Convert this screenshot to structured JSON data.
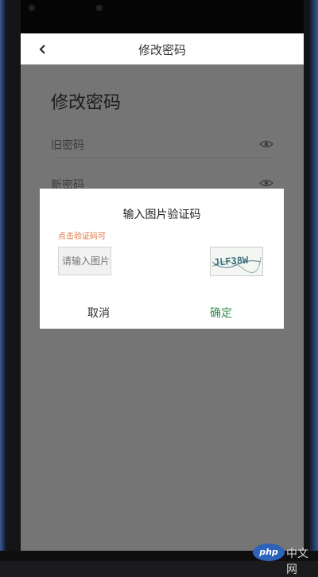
{
  "header": {
    "title": "修改密码"
  },
  "page": {
    "title": "修改密码",
    "old_password_label": "旧密码",
    "new_password_label": "新密码"
  },
  "dialog": {
    "title": "输入图片验证码",
    "hint": "点击验证码可",
    "captcha_placeholder": "请输入图片",
    "cancel_label": "取消",
    "confirm_label": "确定",
    "captcha_image_text": "JLF38W"
  },
  "colors": {
    "overlay": "#757575",
    "confirm": "#3a8c50",
    "hint": "#e0703c"
  },
  "watermark": {
    "logo": "php",
    "text": "中文网"
  }
}
